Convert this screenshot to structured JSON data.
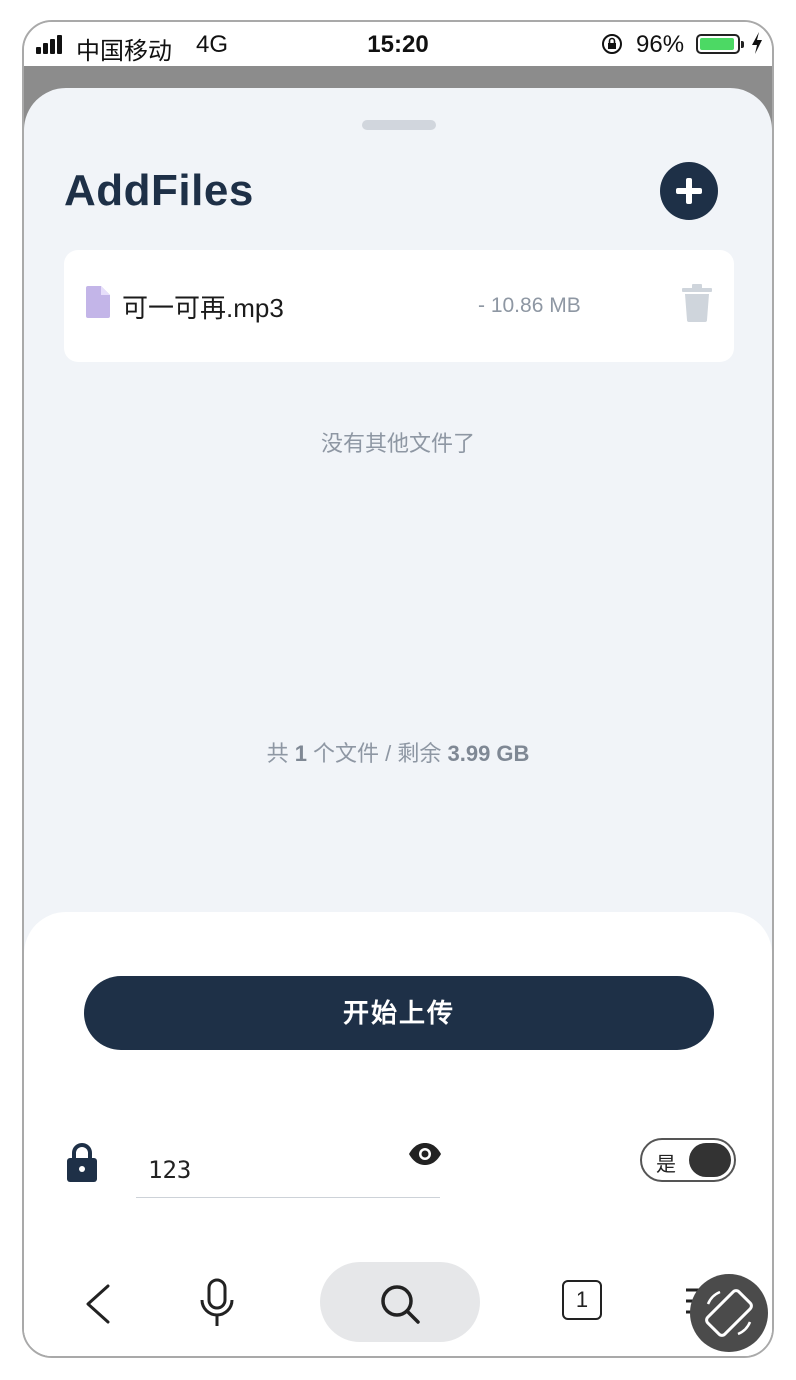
{
  "status_bar": {
    "carrier": "中国移动",
    "network": "4G",
    "time": "15:20",
    "battery_percent": "96%",
    "battery_level": 0.96
  },
  "sheet": {
    "title": "AddFiles",
    "add_icon": "plus-circle-icon"
  },
  "files": [
    {
      "name": "可一可再.mp3",
      "size": "- 10.86 MB",
      "icon": "file-icon"
    }
  ],
  "empty_note": "没有其他文件了",
  "summary": {
    "prefix": "共 ",
    "count": "1",
    "middle": " 个文件 / 剩余 ",
    "remaining": "3.99 GB"
  },
  "upload": {
    "button_label": "开始上传"
  },
  "password": {
    "value": "123",
    "toggle_label": "是",
    "toggle_on": true
  },
  "browser": {
    "tab_count": "1"
  },
  "colors": {
    "primary": "#1e3047",
    "background": "#f1f4f8",
    "muted_text": "#8e97a3",
    "file_icon": "#c3b5e8"
  }
}
